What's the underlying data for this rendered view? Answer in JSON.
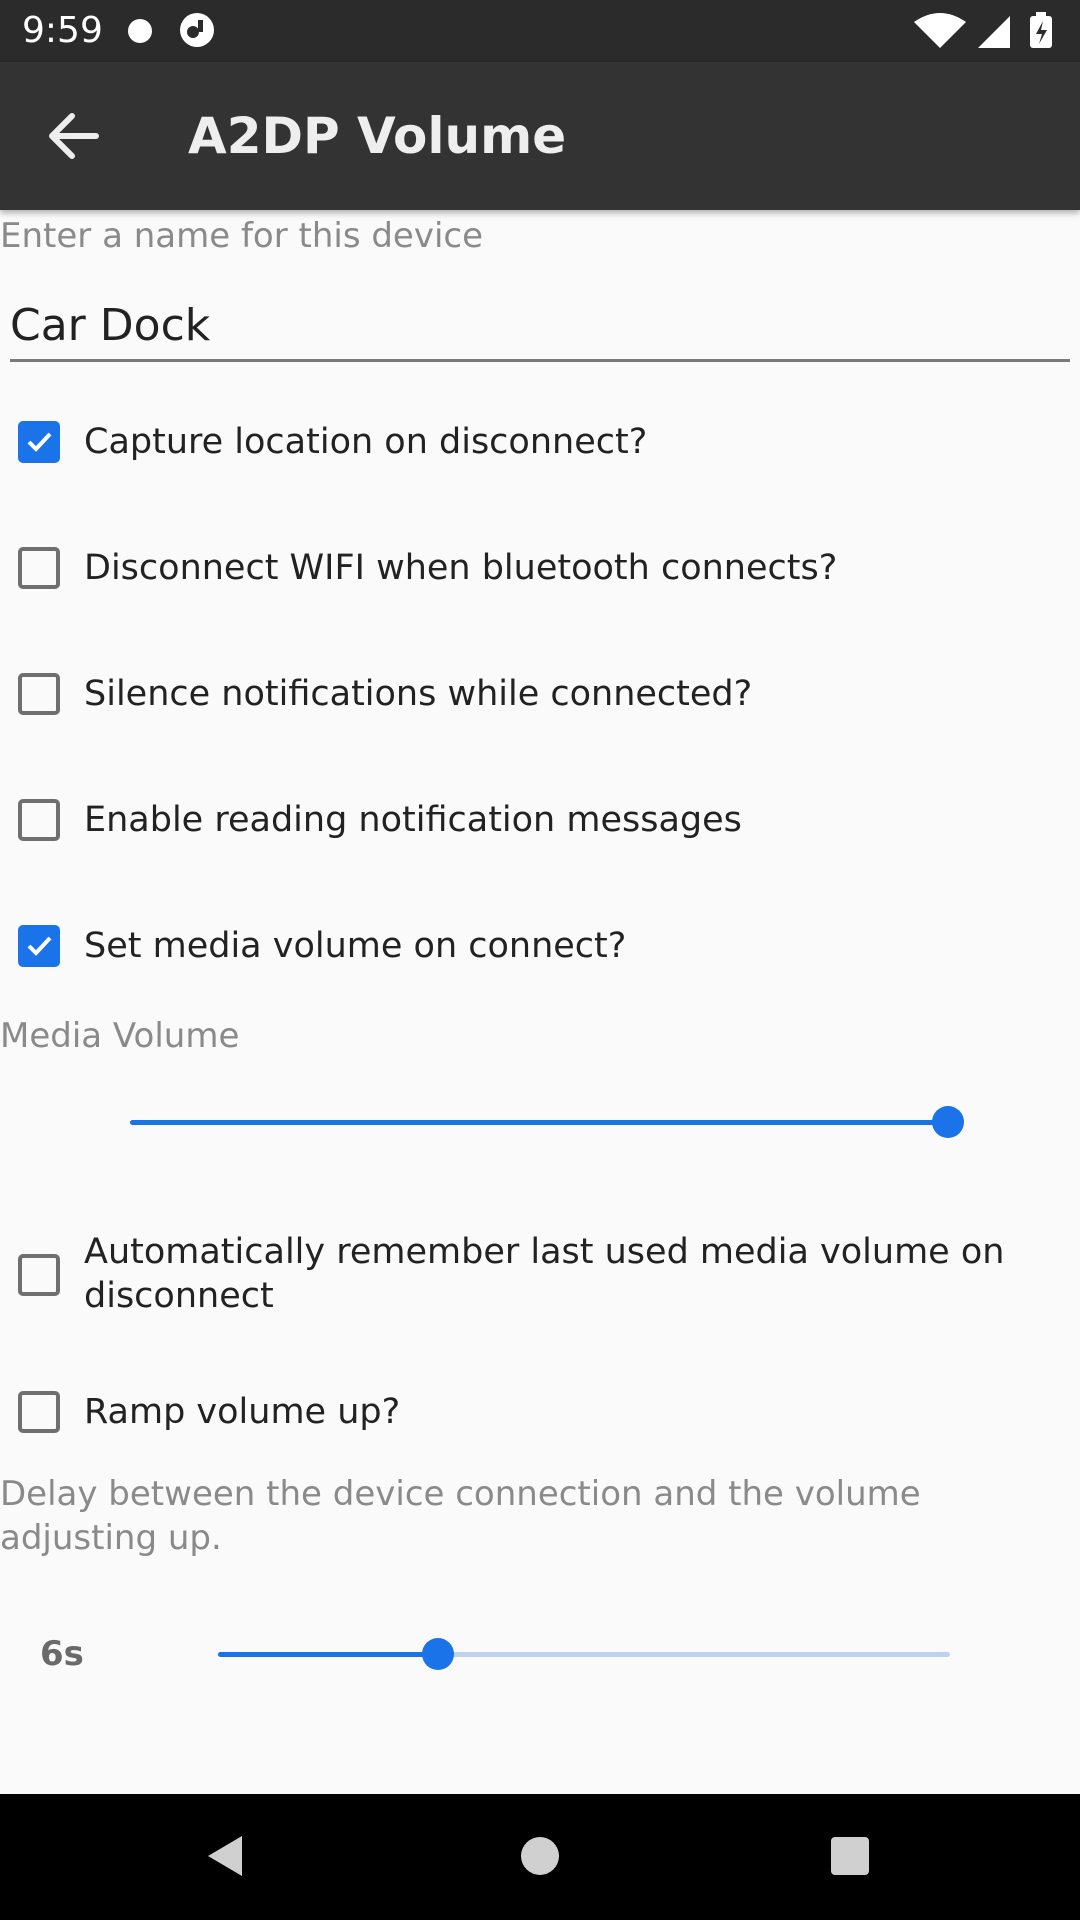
{
  "status_bar": {
    "time": "9:59",
    "icons": [
      "notification-dot-icon",
      "app-icon",
      "wifi-icon",
      "signal-icon",
      "battery-icon"
    ]
  },
  "app_bar": {
    "title": "A2DP Volume",
    "back_icon": "arrow-back-icon"
  },
  "device_name": {
    "label": "Enter a name for this device",
    "value": "Car Dock"
  },
  "options": [
    {
      "label": "Capture location on disconnect?",
      "checked": true
    },
    {
      "label": "Disconnect WIFI when bluetooth connects?",
      "checked": false
    },
    {
      "label": "Silence notifications while connected?",
      "checked": false
    },
    {
      "label": "Enable reading notification messages",
      "checked": false
    },
    {
      "label": "Set media volume on connect?",
      "checked": true
    }
  ],
  "media_volume": {
    "label": "Media Volume",
    "level_fraction": 1.0
  },
  "options2": [
    {
      "label": "Automatically remember last used media volume on disconnect",
      "checked": false
    },
    {
      "label": "Ramp volume up?",
      "checked": false
    }
  ],
  "delay": {
    "label": "Delay between the device connection and the volume adjusting up.",
    "value": "6s",
    "level_fraction": 0.3
  },
  "colors": {
    "accent": "#1a73e8",
    "app_bar": "#333333",
    "status_bar": "#2b2b2b",
    "background": "#fafafa"
  },
  "nav_bar": {
    "icons": [
      "back-triangle-icon",
      "home-circle-icon",
      "recents-square-icon"
    ]
  }
}
